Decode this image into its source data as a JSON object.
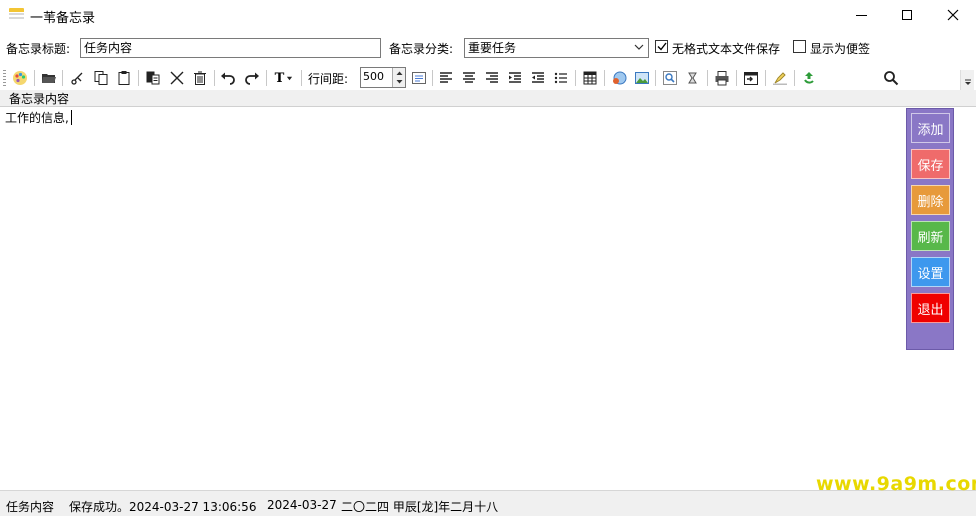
{
  "window": {
    "title": "一苇备忘录"
  },
  "form": {
    "title_label": "备忘录标题:",
    "title_value": "任务内容",
    "category_label": "备忘录分类:",
    "category_value": "重要任务",
    "plain_text_save_label": "无格式文本文件保存",
    "plain_text_save_checked": true,
    "show_as_sticky_label": "显示为便签",
    "show_as_sticky_checked": false
  },
  "toolbar": {
    "line_spacing_label": "行间距:",
    "line_spacing_value": "500",
    "text_format_label": "T",
    "icons": [
      "palette-icon",
      "open-folder-icon",
      "cut-icon",
      "copy-icon",
      "paste-icon",
      "paste-special-icon",
      "delete-icon",
      "trash-icon",
      "undo-icon",
      "redo-icon",
      "text-format-icon",
      "paragraph-icon",
      "align-left-icon",
      "align-center-icon",
      "align-right-icon",
      "indent-icon",
      "outdent-icon",
      "bullet-list-icon",
      "table-icon",
      "insert-link-icon",
      "insert-image-icon",
      "find-icon",
      "replace-icon",
      "print-icon",
      "insert-date-icon",
      "highlight-icon",
      "recycle-icon",
      "search-icon"
    ]
  },
  "editor": {
    "header": "备忘录内容",
    "content": "工作的信息,"
  },
  "side_panel": {
    "buttons": [
      {
        "label": "添加",
        "color": "#8a77c6"
      },
      {
        "label": "保存",
        "color": "#ef6b6b"
      },
      {
        "label": "删除",
        "color": "#e79a3b"
      },
      {
        "label": "刷新",
        "color": "#58b84a"
      },
      {
        "label": "设置",
        "color": "#3d98ee"
      },
      {
        "label": "退出",
        "color": "#f00000"
      }
    ]
  },
  "status": {
    "memo_name": "任务内容",
    "message": "保存成功。2024-03-27 13:06:56",
    "date": "2024-03-27",
    "lunar_date": "二〇二四 甲辰[龙]年二月十八"
  },
  "watermark": "www.9a9m.com"
}
